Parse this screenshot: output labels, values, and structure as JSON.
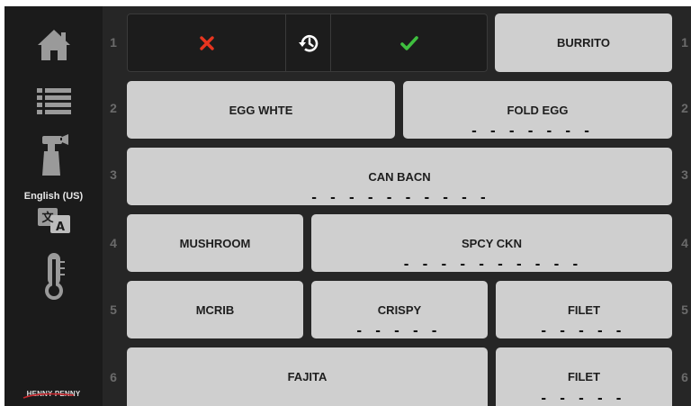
{
  "sidebar": {
    "home_icon": "home-icon",
    "menu_icon": "list-icon",
    "clean_icon": "spray-bottle-icon",
    "language_label": "English (US)",
    "language_icon": "translate-icon",
    "temperature_icon": "thermometer-icon",
    "brand": "HENNY PENNY"
  },
  "rows": [
    "1",
    "2",
    "3",
    "4",
    "5",
    "6"
  ],
  "action_bar": {
    "cancel_icon": "close-icon",
    "history_icon": "history-icon",
    "confirm_icon": "check-icon",
    "colors": {
      "cancel": "#e8351f",
      "confirm": "#3fbf3f"
    }
  },
  "products": [
    {
      "name": "BURRITO",
      "has_dashes": false
    },
    {
      "name": "EGG WHTE",
      "has_dashes": false
    },
    {
      "name": "FOLD EGG",
      "has_dashes": true
    },
    {
      "name": "CAN BACN",
      "has_dashes": true
    },
    {
      "name": "MUSHROOM",
      "has_dashes": false
    },
    {
      "name": "SPCY CKN",
      "has_dashes": true
    },
    {
      "name": "MCRIB",
      "has_dashes": false
    },
    {
      "name": "CRISPY",
      "has_dashes": true
    },
    {
      "name": "FILET",
      "has_dashes": true
    },
    {
      "name": "FAJITA",
      "has_dashes": false
    },
    {
      "name": "FILET",
      "has_dashes": true
    }
  ],
  "dash_text": "- - - - - - - - - -",
  "colors": {
    "sidebar_bg": "#1b1b1b",
    "main_bg": "#262626",
    "button_bg": "#cfcfcf",
    "button_text": "#1e1e1e",
    "row_number": "#6b6b6b"
  }
}
